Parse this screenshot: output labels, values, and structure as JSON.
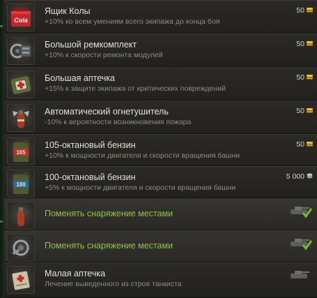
{
  "items": [
    {
      "title": "Ящик Колы",
      "desc": "+10% ко всем умениям всего экипажа до конца боя",
      "price": "50",
      "currency": "gold",
      "icon": "cola-crate-icon"
    },
    {
      "title": "Большой ремкомплект",
      "desc": "+10% к скорости ремонта модулей",
      "price": "50",
      "currency": "gold",
      "icon": "large-repair-kit-icon"
    },
    {
      "title": "Большая аптечка",
      "desc": "+15% к защите экипажа от критических повреждений",
      "price": "50",
      "currency": "gold",
      "icon": "large-first-aid-kit-icon"
    },
    {
      "title": "Автоматический огнетушитель",
      "desc": "-10% к вероятности возникновения пожара",
      "price": "50",
      "currency": "gold",
      "icon": "automatic-fire-extinguisher-icon"
    },
    {
      "title": "105-октановый бензин",
      "desc": "+10% к мощности двигателя и скорости вращения башни",
      "price": "50",
      "currency": "gold",
      "icon": "gasoline-105-icon"
    },
    {
      "title": "100-октановый бензин",
      "desc": "+5% к мощности двигателя и скорости вращения башни",
      "price": "5 000",
      "currency": "credits",
      "icon": "gasoline-100-icon"
    }
  ],
  "swap_items": [
    {
      "label": "Поменять снаряжение местами",
      "icon": "fire-extinguisher-icon"
    },
    {
      "label": "Поменять снаряжение местами",
      "icon": "repair-kit-icon"
    }
  ],
  "last_item": {
    "title": "Малая аптечка",
    "desc": "Лечение выведенного из строя танкиста",
    "icon": "small-first-aid-kit-icon"
  },
  "colors": {
    "gold": "#e8c23a",
    "credits": "#b9bcc0",
    "swap_text": "#8fc24a",
    "check": "#6fbf2f"
  }
}
